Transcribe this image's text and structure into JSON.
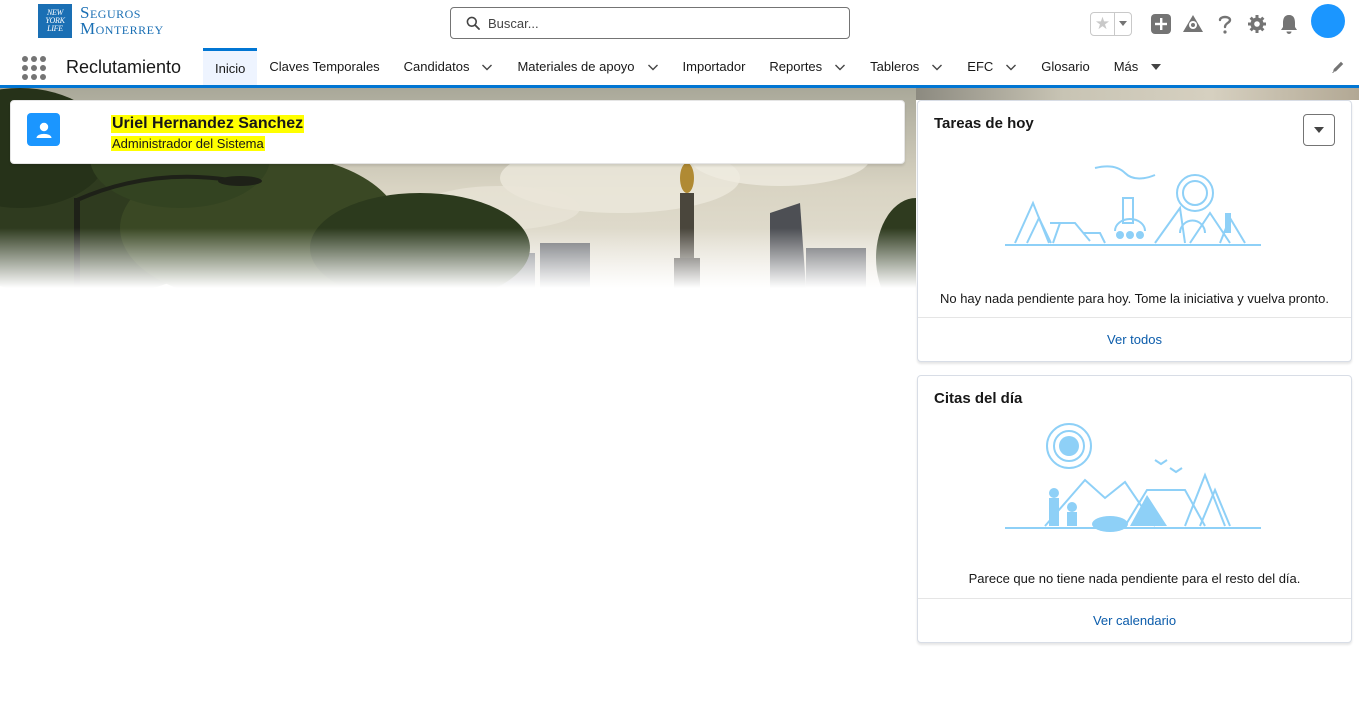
{
  "header": {
    "logo": {
      "box_lines": [
        "NEW",
        "YORK",
        "LIFE"
      ],
      "text_line1": "Seguros",
      "text_line2": "Monterrey"
    },
    "search": {
      "placeholder": "Buscar..."
    },
    "icons": [
      "favorites-star-icon",
      "add-icon",
      "trailhead-icon",
      "help-icon",
      "setup-gear-icon",
      "notifications-bell-icon"
    ]
  },
  "nav": {
    "app_name": "Reclutamiento",
    "tabs": [
      {
        "label": "Inicio",
        "active": true,
        "dropdown": false
      },
      {
        "label": "Claves Temporales",
        "dropdown": false
      },
      {
        "label": "Candidatos",
        "dropdown": true
      },
      {
        "label": "Materiales de apoyo",
        "dropdown": true
      },
      {
        "label": "Importador",
        "dropdown": false
      },
      {
        "label": "Reportes",
        "dropdown": true
      },
      {
        "label": "Tableros",
        "dropdown": true
      },
      {
        "label": "EFC",
        "dropdown": true
      },
      {
        "label": "Glosario",
        "dropdown": false
      },
      {
        "label": "Más",
        "dropdown": true
      }
    ]
  },
  "user": {
    "name": "Uriel Hernandez Sanchez",
    "role": "Administrador del Sistema"
  },
  "tasks_card": {
    "title": "Tareas de hoy",
    "message": "No hay nada pendiente para hoy. Tome la iniciativa y vuelva pronto.",
    "footer_link": "Ver todos"
  },
  "events_card": {
    "title": "Citas del día",
    "message": "Parece que no tiene nada pendiente para el resto del día.",
    "footer_link": "Ver calendario"
  },
  "colors": {
    "brand": "#0176d3",
    "avatar": "#1b96ff",
    "highlight": "#ffff00",
    "link": "#0b5cab",
    "logo": "#1a6fb4"
  }
}
